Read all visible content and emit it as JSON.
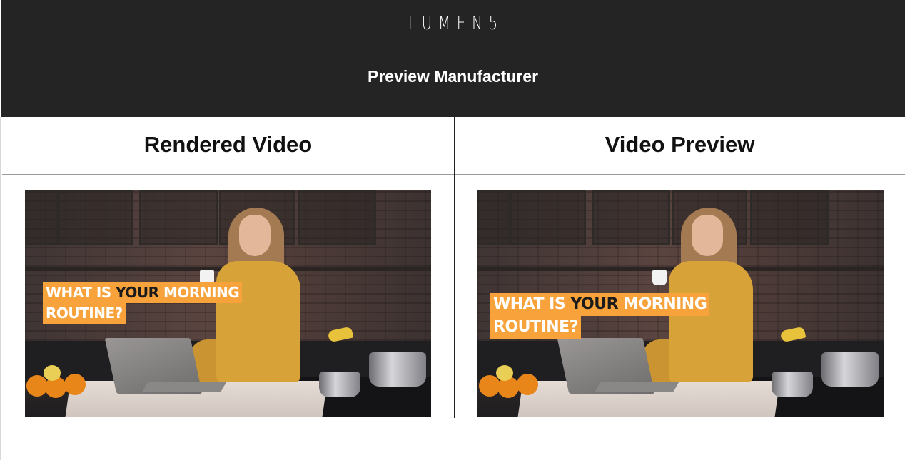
{
  "header": {
    "logo": "LUMEN5",
    "subtitle": "Preview Manufacturer"
  },
  "columns": {
    "left": {
      "title": "Rendered Video"
    },
    "right": {
      "title": "Video Preview"
    }
  },
  "video": {
    "caption_line1_pre": "WHAT IS ",
    "caption_line1_highlight": "YOUR",
    "caption_line1_post": " MORNING",
    "caption_line2": "ROUTINE?",
    "caption_bg": "#f7a23b"
  },
  "colors": {
    "header_bg": "#252424",
    "header_text": "#ffffff",
    "caption_highlight": "#1b1b1b"
  }
}
